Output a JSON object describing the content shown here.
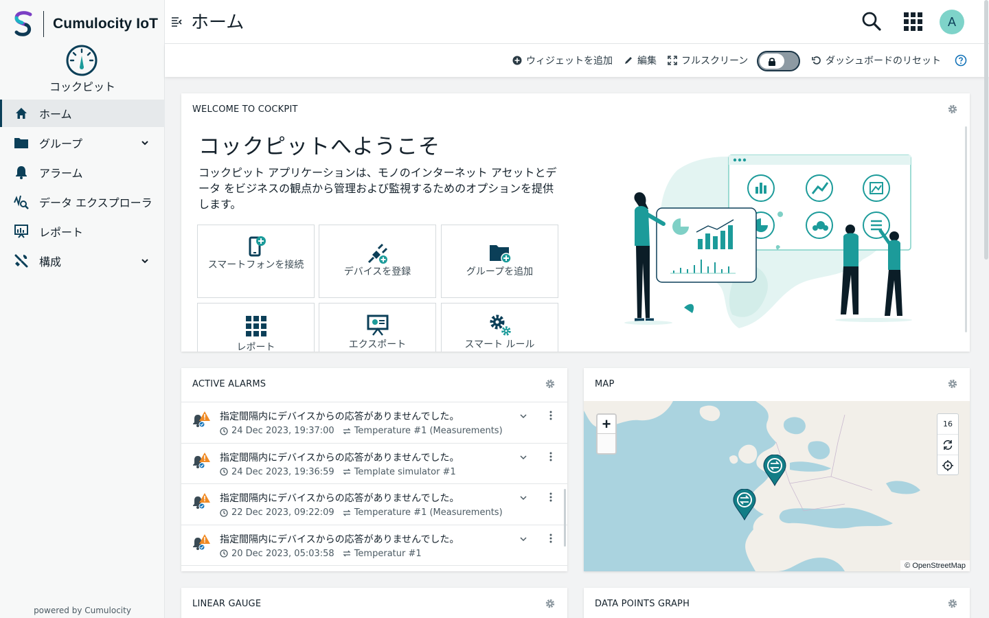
{
  "brand": {
    "name": "Cumulocity IoT"
  },
  "app": {
    "name": "コックピット",
    "icon": "gauge-icon"
  },
  "sidebar": {
    "items": [
      {
        "label": "ホーム",
        "icon": "home-icon",
        "active": true
      },
      {
        "label": "グループ",
        "icon": "folder-icon",
        "expandable": true
      },
      {
        "label": "アラーム",
        "icon": "bell-icon"
      },
      {
        "label": "データ エクスプローラ",
        "icon": "data-explorer-icon"
      },
      {
        "label": "レポート",
        "icon": "report-icon"
      },
      {
        "label": "構成",
        "icon": "wrench-icon",
        "expandable": true
      }
    ],
    "powered_by": "powered by Cumulocity"
  },
  "header": {
    "title": "ホーム",
    "avatar_initial": "A"
  },
  "actions": {
    "add_widget": "ウィジェットを追加",
    "edit": "編集",
    "fullscreen": "フルスクリーン",
    "reset": "ダッシュボードのリセット"
  },
  "welcome": {
    "title": "WELCOME TO COCKPIT",
    "heading": "コックピットへようこそ",
    "description": "コックピット アプリケーションは、モノのインターネット アセットとデータ をビジネスの観点から管理および監視するためのオプションを提供します。",
    "quick_actions": [
      {
        "label": "スマートフォンを接続",
        "icon": "smartphone-add-icon"
      },
      {
        "label": "デバイスを登録",
        "icon": "plug-add-icon"
      },
      {
        "label": "グループを追加",
        "icon": "folder-add-icon"
      },
      {
        "label": "レポート",
        "icon": "grid-report-icon"
      },
      {
        "label": "エクスポート",
        "icon": "presentation-export-icon"
      },
      {
        "label": "スマート ルール",
        "icon": "gears-icon"
      }
    ]
  },
  "alarms": {
    "title": "ACTIVE ALARMS",
    "rows": [
      {
        "text": "指定間隔内にデバイスからの応答がありませんでした。",
        "time": "24 Dec 2023, 19:37:00",
        "source": "Temperature #1 (Measurements)"
      },
      {
        "text": "指定間隔内にデバイスからの応答がありませんでした。",
        "time": "24 Dec 2023, 19:36:59",
        "source": "Template simulator #1"
      },
      {
        "text": "指定間隔内にデバイスからの応答がありませんでした。",
        "time": "22 Dec 2023, 09:22:09",
        "source": "Temperature #1 (Measurements)"
      },
      {
        "text": "指定間隔内にデバイスからの応答がありませんでした。",
        "time": "20 Dec 2023, 05:03:58",
        "source": "Temperatur #1"
      }
    ]
  },
  "map": {
    "title": "MAP",
    "zoom_in": "+",
    "zoom_level": "16",
    "attribution": "© OpenStreetMap"
  },
  "gauge": {
    "title": "LINEAR GAUGE"
  },
  "dpgraph": {
    "title": "DATA POINTS GRAPH"
  },
  "colors": {
    "accent": "#1c9b9a",
    "navy": "#0b3f58",
    "warning": "#f08a24"
  }
}
